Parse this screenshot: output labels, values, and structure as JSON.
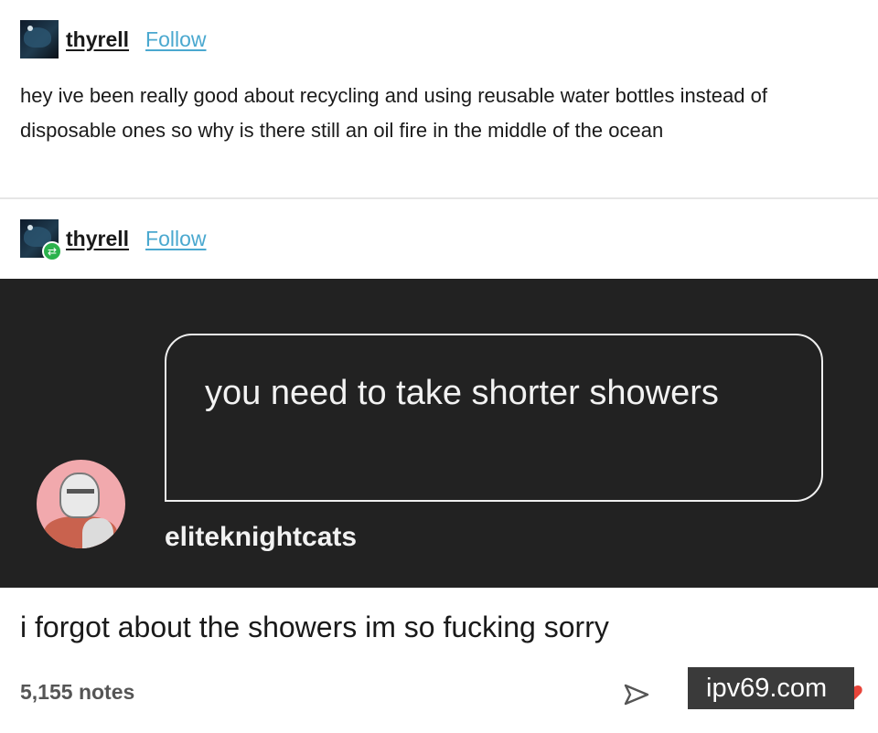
{
  "post": {
    "author": "thyrell",
    "follow_label": "Follow",
    "text": "hey ive been really good about recycling and using reusable water bottles instead of disposable ones so why is there still an oil fire in the middle of the ocean"
  },
  "reblog": {
    "author": "thyrell",
    "follow_label": "Follow",
    "ask": {
      "question": "you need to take shorter showers",
      "asker": "eliteknightcats"
    },
    "answer": "i forgot about the showers im so fucking sorry"
  },
  "footer": {
    "notes": "5,155 notes",
    "icons": [
      "share-icon",
      "reply-icon",
      "heart-icon"
    ]
  },
  "watermark": {
    "text": "ipv69.com"
  },
  "colors": {
    "link": "#4aa8cf",
    "reblog": "#2bb24c",
    "ask_background": "#222222",
    "heart": "#e8443a"
  }
}
